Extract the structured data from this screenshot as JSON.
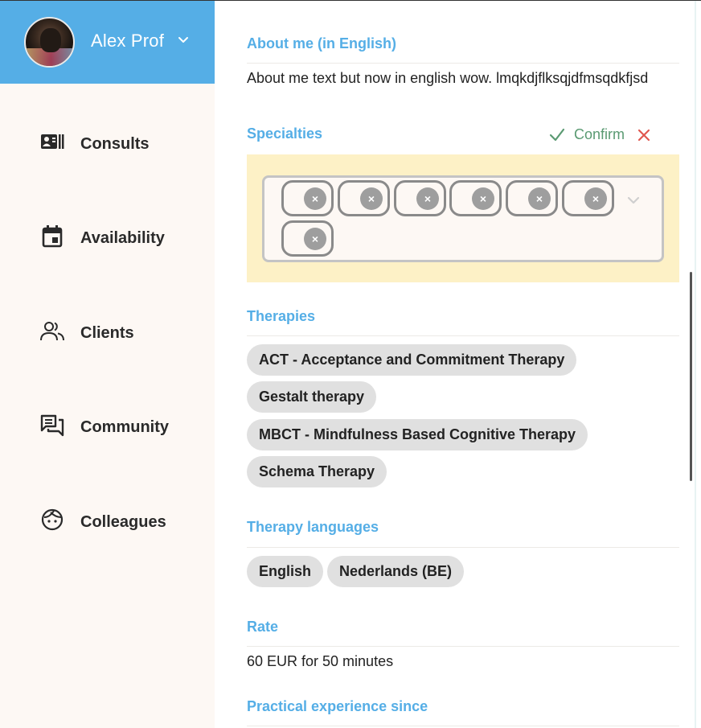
{
  "profile": {
    "name": "Alex Prof",
    "avatar_icon": "dog-avatar-photo"
  },
  "nav": [
    {
      "label": "Consults",
      "icon": "contact-card-icon"
    },
    {
      "label": "Availability",
      "icon": "calendar-icon"
    },
    {
      "label": "Clients",
      "icon": "people-icon"
    },
    {
      "label": "Community",
      "icon": "chat-bubbles-icon"
    },
    {
      "label": "Colleagues",
      "icon": "face-icon"
    }
  ],
  "about": {
    "title": "About me (in English)",
    "text": "About me text but now in english wow. lmqkdjflksqjdfmsqdkfjsd"
  },
  "specialties": {
    "title": "Specialties",
    "confirm_label": "Confirm",
    "tags": [
      "",
      "",
      "",
      "",
      "",
      "",
      ""
    ],
    "colors": {
      "panel": "#fdf1c6",
      "confirm": "#5a9a72",
      "cancel": "#e0574f"
    }
  },
  "therapies": {
    "title": "Therapies",
    "items": [
      "ACT - Acceptance and Commitment Therapy",
      "Gestalt therapy",
      "MBCT - Mindfulness Based Cognitive Therapy",
      "Schema Therapy"
    ]
  },
  "languages": {
    "title": "Therapy languages",
    "items": [
      "English",
      "Nederlands (BE)"
    ]
  },
  "rate": {
    "title": "Rate",
    "text": "60 EUR for 50 minutes"
  },
  "experience": {
    "title": "Practical experience since"
  },
  "colors": {
    "accent": "#55aee6",
    "sidebar": "#fdf8f4"
  }
}
